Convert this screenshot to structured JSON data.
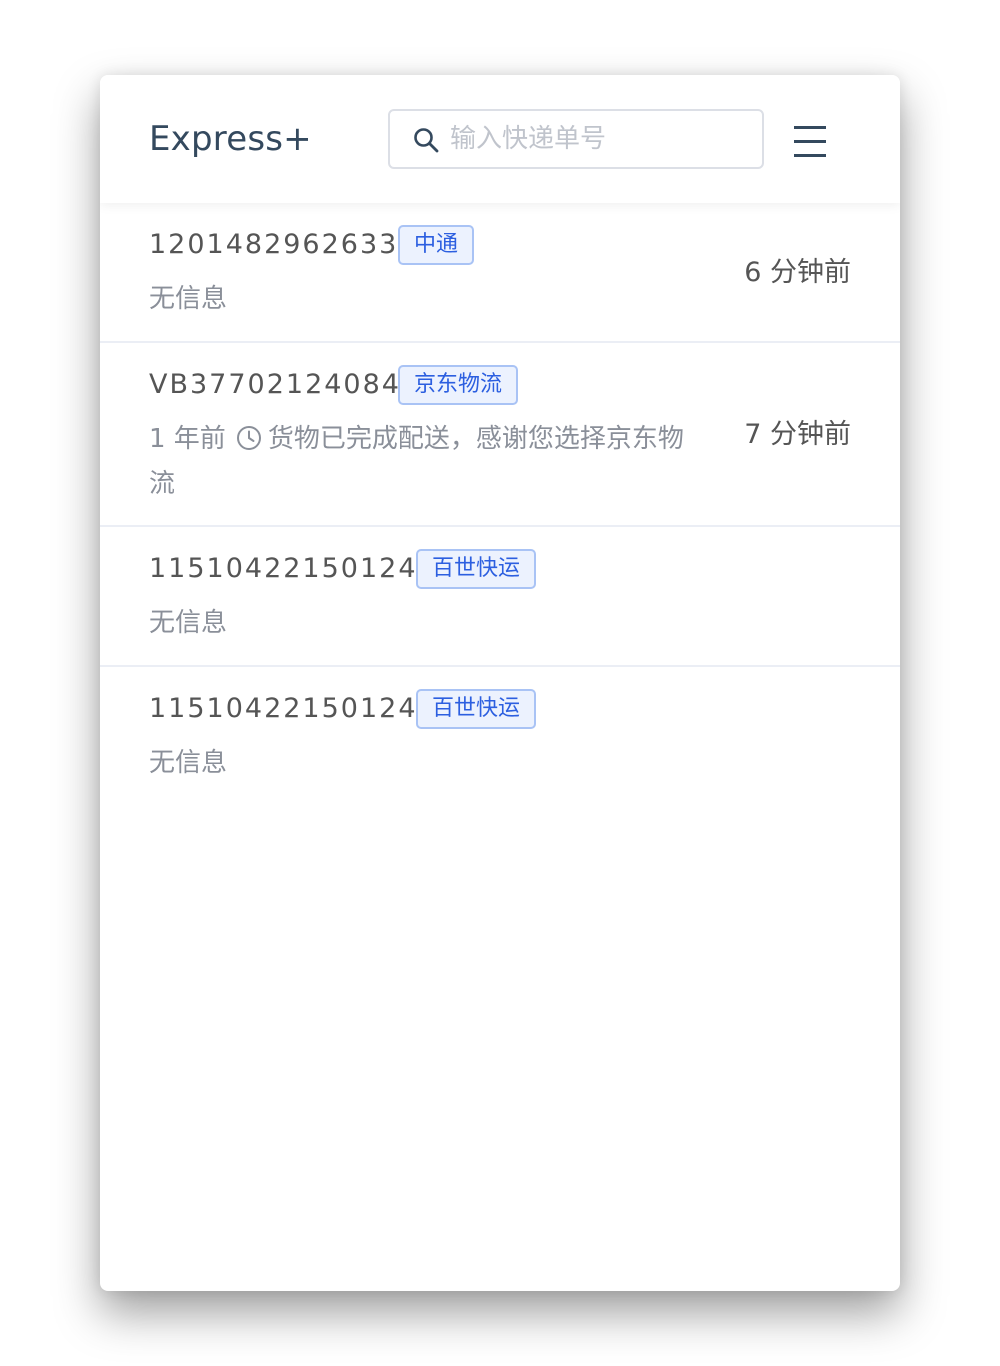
{
  "header": {
    "brand": "Express+",
    "search_placeholder": "输入快递单号",
    "search_icon": "search-icon",
    "menu_icon": "hamburger-menu-icon"
  },
  "colors": {
    "brand_text": "#34495e",
    "tag_text": "#2c5fe0",
    "tag_bg": "#ecf2fe",
    "tag_border": "#a9c3f5",
    "muted_text": "#8a8f99"
  },
  "items": [
    {
      "tracking": "1201482962633",
      "carrier": "中通",
      "info": "无信息",
      "time": "6 分钟前"
    },
    {
      "tracking": "VB37702124084",
      "carrier": "京东物流",
      "info_prefix": "1 年前",
      "info_icon": "clock-icon",
      "info_line1": "货物已完成配送，感谢您选择京东物",
      "info_line2": "流",
      "time": "7 分钟前"
    },
    {
      "tracking": "11510422150124",
      "carrier": "百世快运",
      "info": "无信息",
      "time": ""
    },
    {
      "tracking": "11510422150124",
      "carrier": "百世快运",
      "info": "无信息",
      "time": ""
    }
  ]
}
